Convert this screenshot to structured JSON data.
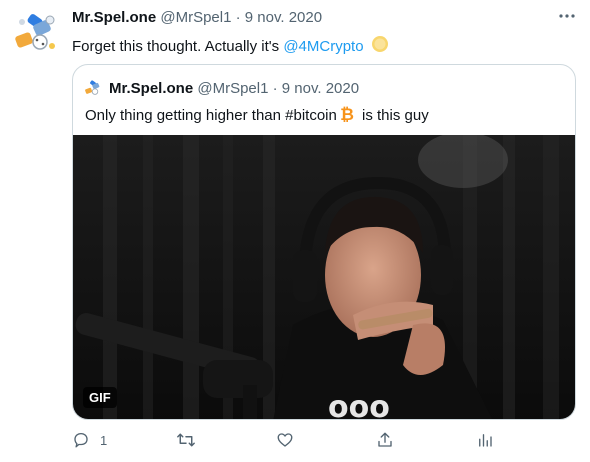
{
  "tweet": {
    "display_name": "Mr.Spel.one",
    "handle": "@MrSpel1",
    "date": "9 nov. 2020",
    "separator": "·",
    "text_prefix": "Forget this thought. Actually it's ",
    "mention": "@4MCrypto",
    "emoji_icon": "coin-icon"
  },
  "quoted": {
    "display_name": "Mr.Spel.one",
    "handle": "@MrSpel1",
    "date": "9 nov. 2020",
    "separator": "·",
    "text_prefix": "Only thing getting higher than #bitcoin",
    "text_suffix": " is this guy",
    "emoji_icon": "bitcoin-icon",
    "gif_label": "GIF"
  },
  "actions": {
    "reply_count": "1",
    "icons": [
      "reply-icon",
      "retweet-icon",
      "like-icon",
      "share-icon",
      "analytics-icon"
    ]
  },
  "colors": {
    "link": "#1d9bf0",
    "muted": "#536471",
    "border": "#cfd9de",
    "bitcoin": "#f7931a"
  }
}
